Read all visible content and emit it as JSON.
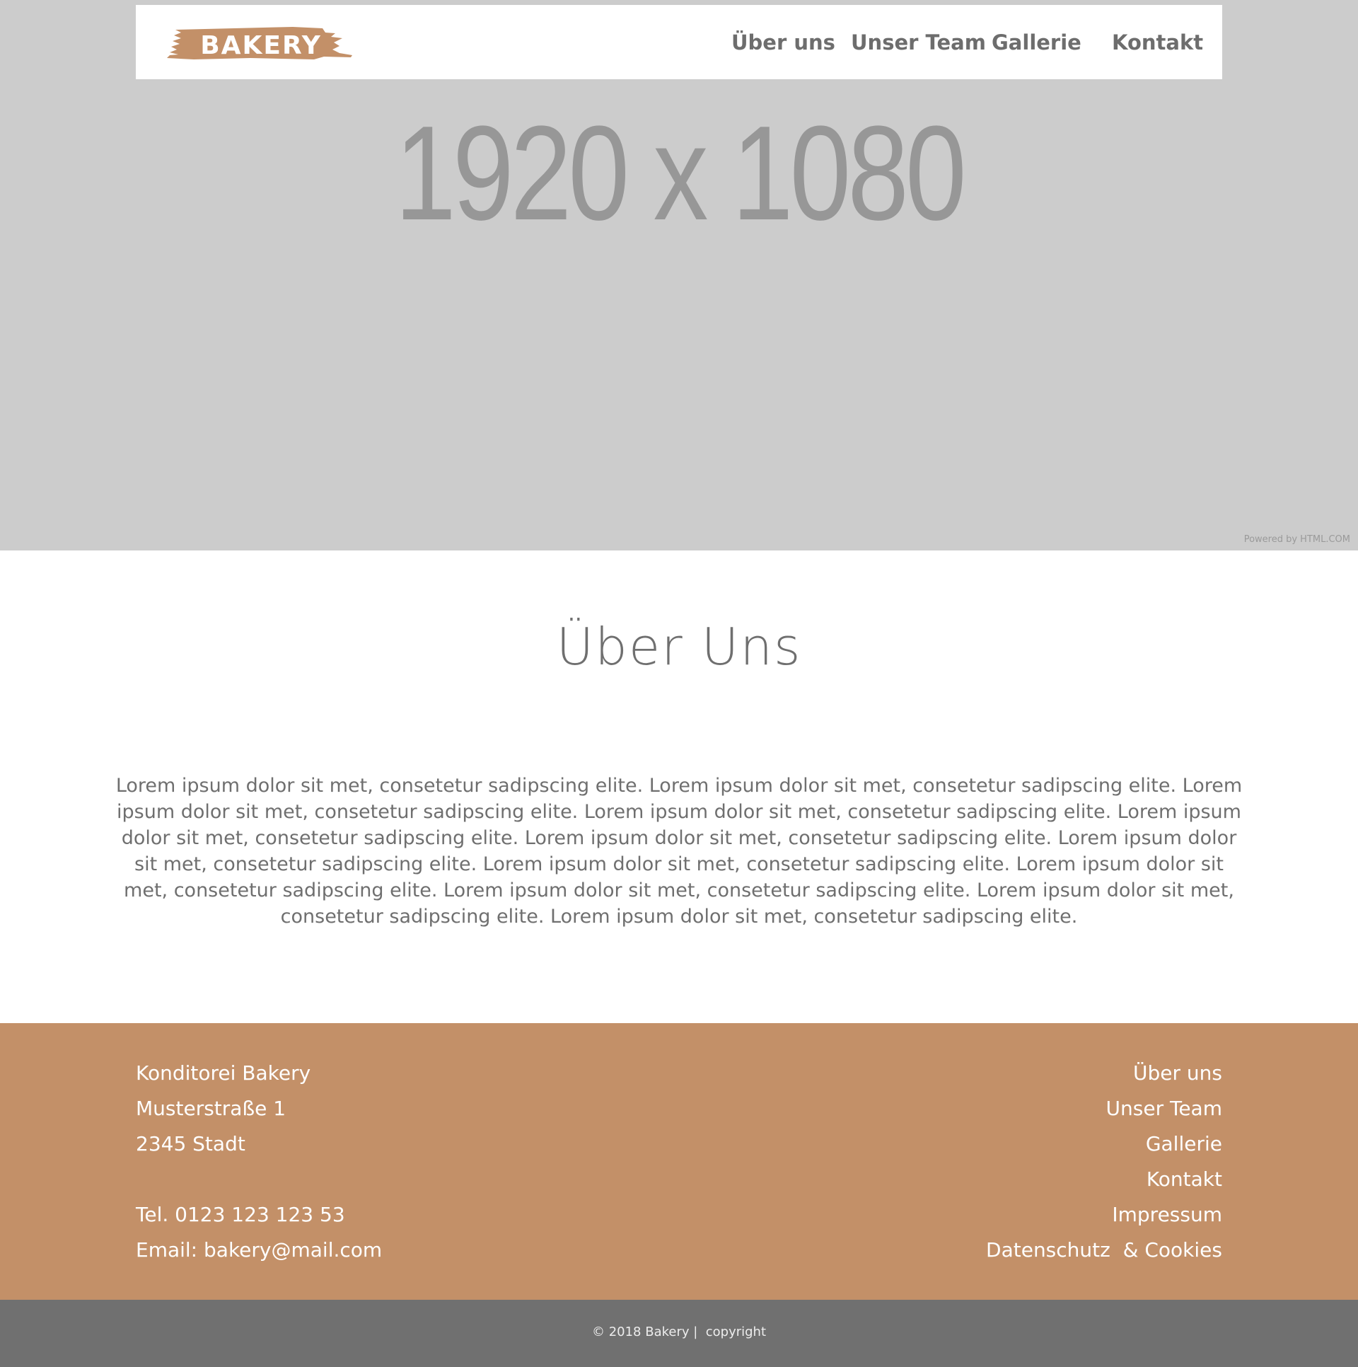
{
  "hero": {
    "placeholder_text": "1920 x 1080",
    "powered_by": "Powered by HTML.COM",
    "background_color": "#cccccc"
  },
  "header": {
    "logo_text": "BAKERY",
    "nav": [
      {
        "label": "Über uns"
      },
      {
        "label": "Unser Team"
      },
      {
        "label": "Gallerie"
      },
      {
        "label": "Kontakt"
      }
    ]
  },
  "about": {
    "title": "Über Uns",
    "text": "Lorem ipsum dolor sit met, consetetur sadipscing elite. Lorem ipsum dolor sit met, consetetur sadipscing elite. Lorem ipsum dolor sit met, consetetur sadipscing elite. Lorem ipsum dolor sit met, consetetur sadipscing elite. Lorem ipsum dolor sit met, consetetur sadipscing elite. Lorem ipsum dolor sit met, consetetur sadipscing elite. Lorem ipsum dolor sit met, consetetur sadipscing elite. Lorem ipsum dolor sit met, consetetur sadipscing elite. Lorem ipsum dolor sit met, consetetur sadipscing elite. Lorem ipsum dolor sit met, consetetur sadipscing elite. Lorem ipsum dolor sit met, consetetur sadipscing elite. Lorem ipsum dolor sit met, consetetur sadipscing elite."
  },
  "footer": {
    "address": {
      "name": "Konditorei Bakery",
      "street": "Musterstraße 1",
      "city": "2345 Stadt",
      "phone": "Tel. 0123 123 123 53",
      "email": "Email: bakery@mail.com"
    },
    "links": [
      {
        "label": "Über uns"
      },
      {
        "label": "Unser Team"
      },
      {
        "label": "Gallerie"
      },
      {
        "label": "Kontakt"
      },
      {
        "label": "Impressum"
      },
      {
        "label": "Datenschutz  & Cookies"
      }
    ],
    "copyright": "© 2018 Bakery |  copyright"
  },
  "colors": {
    "brand": "#c39068",
    "text_gray": "#6f6f6f",
    "bottom_bar": "#707070"
  }
}
